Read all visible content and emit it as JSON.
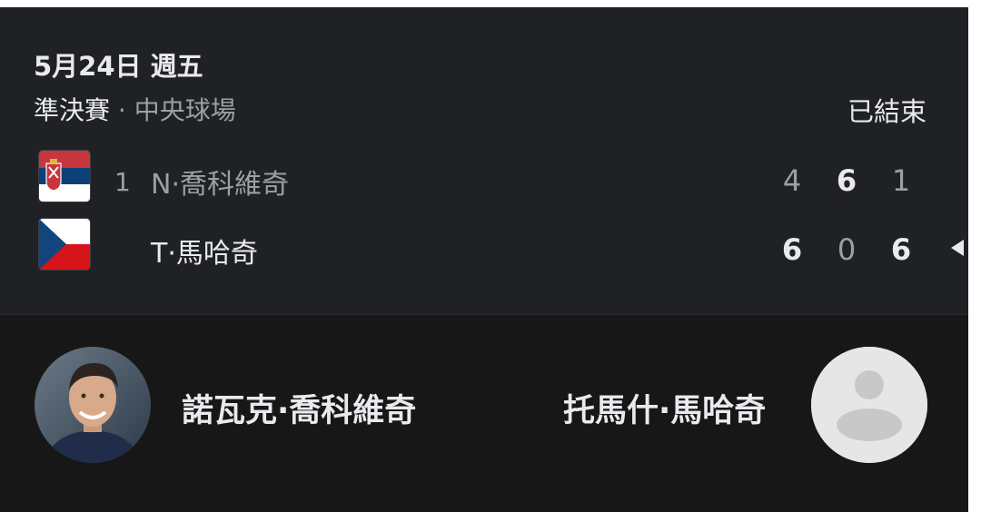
{
  "match": {
    "date": "5月24日 週五",
    "round": "準決賽",
    "separator": " · ",
    "venue": "中央球場",
    "status": "已結束"
  },
  "players": [
    {
      "seed": "1",
      "name": "N·喬科維奇",
      "full_name": "諾瓦克·喬科維奇",
      "flag": "serbia-flag-icon",
      "sets": [
        "4",
        "6",
        "1"
      ]
    },
    {
      "seed": "",
      "name": "T·馬哈奇",
      "full_name": "托馬什·馬哈奇",
      "flag": "czech-flag-icon",
      "sets": [
        "6",
        "0",
        "6"
      ]
    }
  ],
  "icons": {
    "serve_indicator": "serve-indicator-icon",
    "avatar_placeholder": "person-placeholder-icon"
  },
  "colors": {
    "background": "#202124",
    "bottom_background": "#171717",
    "text_primary": "#e8eaed",
    "text_muted": "#9aa0a6"
  }
}
